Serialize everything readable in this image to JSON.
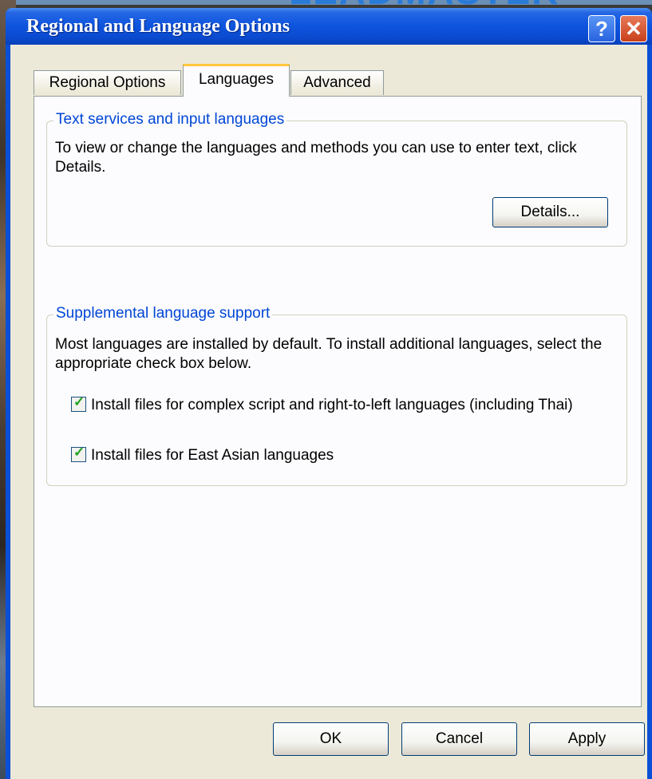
{
  "background": {
    "text": "LEADMASTER"
  },
  "window": {
    "title": "Regional and Language Options",
    "help_glyph": "?",
    "close_glyph": "✕"
  },
  "tabs": [
    {
      "label": "Regional Options",
      "active": false
    },
    {
      "label": "Languages",
      "active": true
    },
    {
      "label": "Advanced",
      "active": false
    }
  ],
  "text_services": {
    "title": "Text services and input languages",
    "description": "To view or change the languages and methods you can use to enter text, click Details.",
    "details_button": "Details..."
  },
  "supplemental": {
    "title": "Supplemental language support",
    "description": "Most languages are installed by default. To install additional languages, select the appropriate check box below.",
    "checkboxes": [
      {
        "label": "Install files for complex script and right-to-left languages (including Thai)",
        "checked": true
      },
      {
        "label": "Install files for East Asian languages",
        "checked": true
      }
    ]
  },
  "footer": {
    "ok": "OK",
    "cancel": "Cancel",
    "apply": "Apply"
  },
  "colors": {
    "titlebar": "#0a4ad0",
    "group_title": "#0046d5",
    "active_tab_highlight": "#ffc83c",
    "checkmark": "#21a121",
    "dialog_face": "#ece9d8"
  },
  "icons": {
    "help": "help-icon",
    "close": "close-icon",
    "checkmark": "checkmark-icon"
  }
}
